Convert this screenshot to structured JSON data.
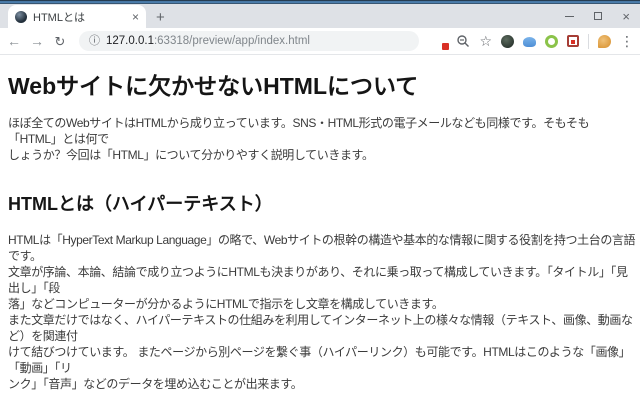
{
  "browser": {
    "tab_title": "HTMLとは",
    "tab_close_icon": "×",
    "new_tab_icon": "+",
    "window_close_icon": "×",
    "back_icon": "←",
    "forward_icon": "→",
    "reload_icon": "↻",
    "info_icon": "ⓘ",
    "url_host": "127.0.0.1",
    "url_path": ":63318/preview/app/index.html",
    "star_icon": "☆",
    "menu_icon": "⋮",
    "accent_color": "#4a7cab",
    "badge_color": "#d93025"
  },
  "page": {
    "heading": "Webサイトに欠かせないHTMLについて",
    "intro": "ほぼ全てのWebサイトはHTMLから成り立っています。SNS・HTML形式の電子メールなども同様です。そもそも「HTML」とは何で\nしょうか？今回は「HTML」について分かりやすく説明していきます。",
    "subheading": "HTMLとは（ハイパーテキスト）",
    "body": "HTMLは「HyperText Markup Language」の略で、Webサイトの根幹の構造や基本的な情報に関する役割を持つ土台の言語です。\n文章が序論、本論、結論で成り立つようにHTMLも決まりがあり、それに乗っ取って構成していきます。「タイトル」「見出し」「段\n落」などコンピューターが分かるようにHTMLで指示をし文章を構成していきます。\nまた文章だけではなく、ハイパーテキストの仕組みを利用してインターネット上の様々な情報（テキスト、画像、動画など）を関連付\nけて結びつけています。 またページから別ページを繋ぐ事（ハイパーリンク）も可能です。HTMLはこのような「画像」「動画」「リ\nンク」「音声」などのデータを埋め込むことが出来ます。"
  }
}
